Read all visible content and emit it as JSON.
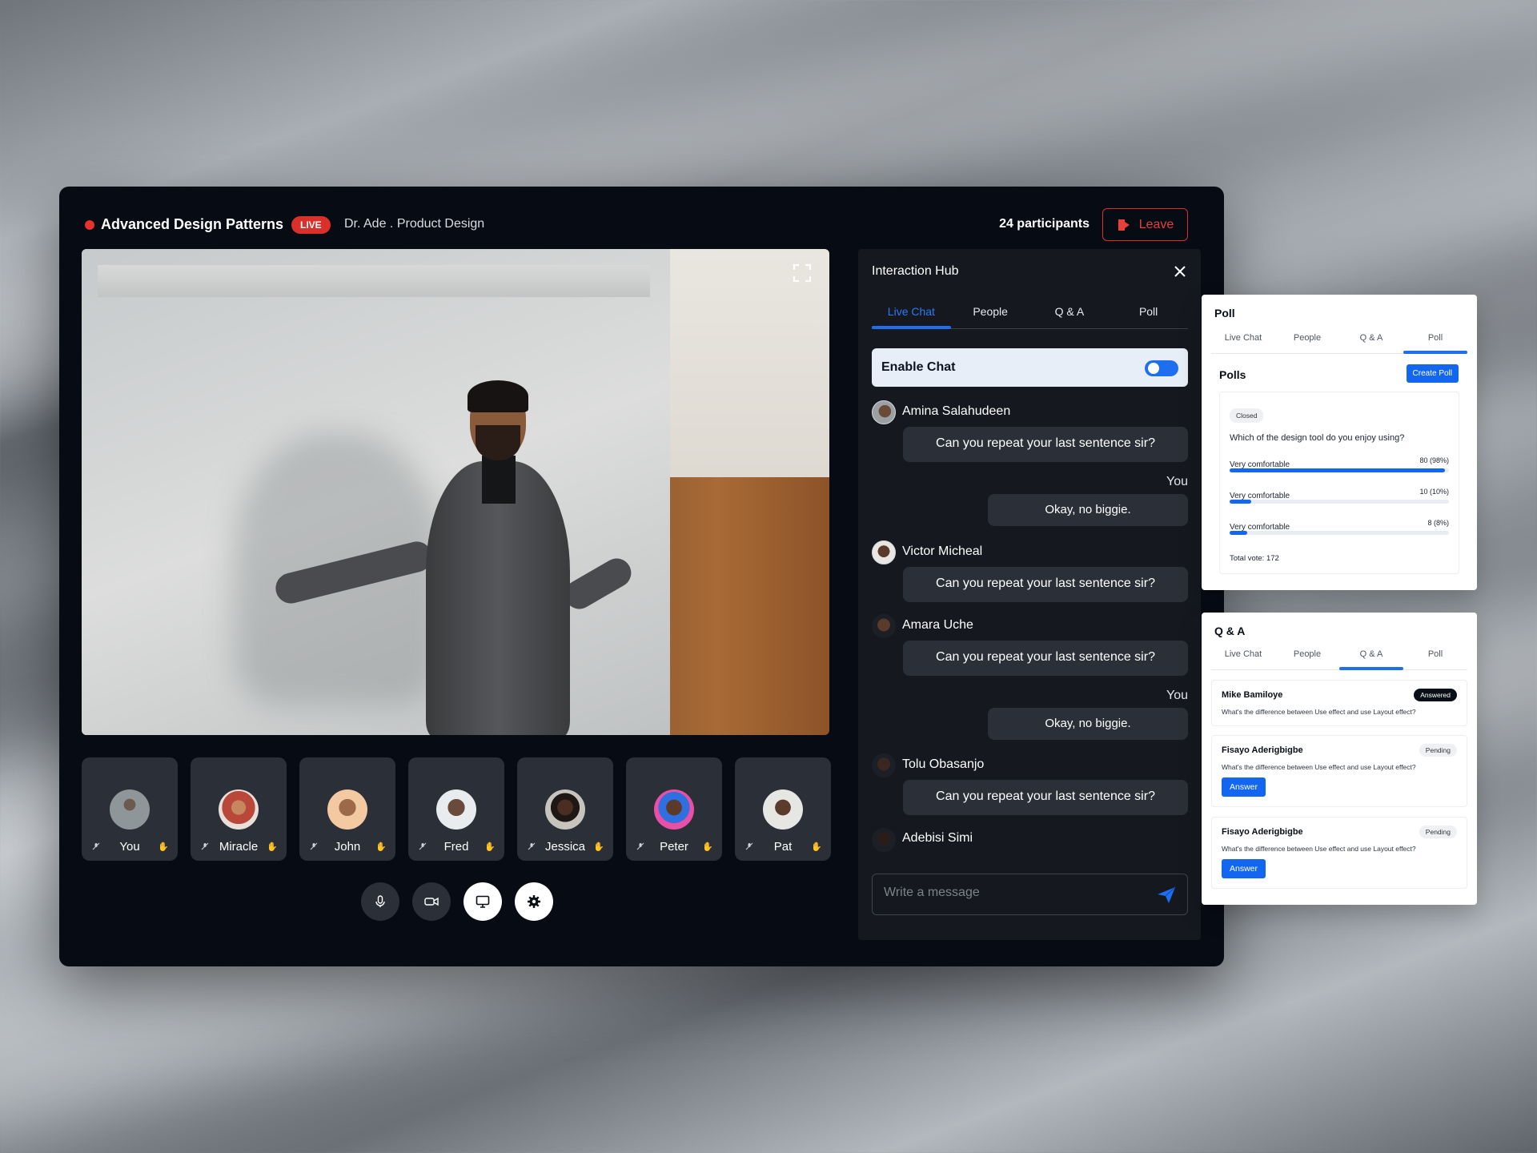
{
  "header": {
    "title": "Advanced Design Patterns",
    "live_badge": "LIVE",
    "host": "Dr. Ade . Product Design",
    "participants": "24 participants",
    "leave_label": "Leave"
  },
  "participants": [
    {
      "name": "You"
    },
    {
      "name": "Miracle"
    },
    {
      "name": "John"
    },
    {
      "name": "Fred"
    },
    {
      "name": "Jessica"
    },
    {
      "name": "Peter"
    },
    {
      "name": "Pat"
    }
  ],
  "hub": {
    "title": "Interaction Hub",
    "tabs": [
      "Live Chat",
      "People",
      "Q & A",
      "Poll"
    ],
    "active_tab": "Live Chat",
    "enable_chat_label": "Enable Chat",
    "enable_chat_on": true,
    "messages": [
      {
        "name": "Amina Salahudeen",
        "text": "Can you repeat your last sentence sir?"
      },
      {
        "you_label": "You",
        "text": "Okay, no biggie."
      },
      {
        "name": "Victor Micheal",
        "text": "Can you repeat your last sentence sir?"
      },
      {
        "name": "Amara Uche",
        "text": "Can you repeat your last sentence sir?"
      },
      {
        "you_label": "You",
        "text": "Okay, no biggie."
      },
      {
        "name": "Tolu Obasanjo",
        "text": "Can you repeat your last sentence sir?"
      },
      {
        "name": "Adebisi Simi"
      }
    ],
    "composer_placeholder": "Write a message"
  },
  "poll_panel": {
    "title": "Poll",
    "tabs": [
      "Live Chat",
      "People",
      "Q & A",
      "Poll"
    ],
    "active_tab": "Poll",
    "polls_label": "Polls",
    "create_label": "Create Poll",
    "status": "Closed",
    "question": "Which of the design tool do you enjoy using?",
    "options": [
      {
        "label": "Very comfortable",
        "value": "80 (98%)",
        "fraction": 0.98
      },
      {
        "label": "Very comfortable",
        "value": "10 (10%)",
        "fraction": 0.1
      },
      {
        "label": "Very comfortable",
        "value": "8 (8%)",
        "fraction": 0.08
      }
    ],
    "total": "Total vote: 172"
  },
  "qa_panel": {
    "title": "Q & A",
    "tabs": [
      "Live Chat",
      "People",
      "Q & A",
      "Poll"
    ],
    "active_tab": "Q & A",
    "items": [
      {
        "name": "Mike Bamiloye",
        "status": "Answered",
        "text": "What's the difference between Use effect  and use Layout effect?"
      },
      {
        "name": "Fisayo Aderigbigbe",
        "status": "Pending",
        "text": "What's the difference between  Use effect  and use Layout effect?",
        "action": "Answer"
      },
      {
        "name": "Fisayo Aderigbigbe",
        "status": "Pending",
        "text": "What's the difference between  Use effect  and use Layout effect?",
        "action": "Answer"
      }
    ]
  },
  "colors": {
    "accent": "#1e6ef0",
    "live_red": "#d9302a",
    "window_bg": "#070b14",
    "tile_bg": "#2b2f38"
  }
}
